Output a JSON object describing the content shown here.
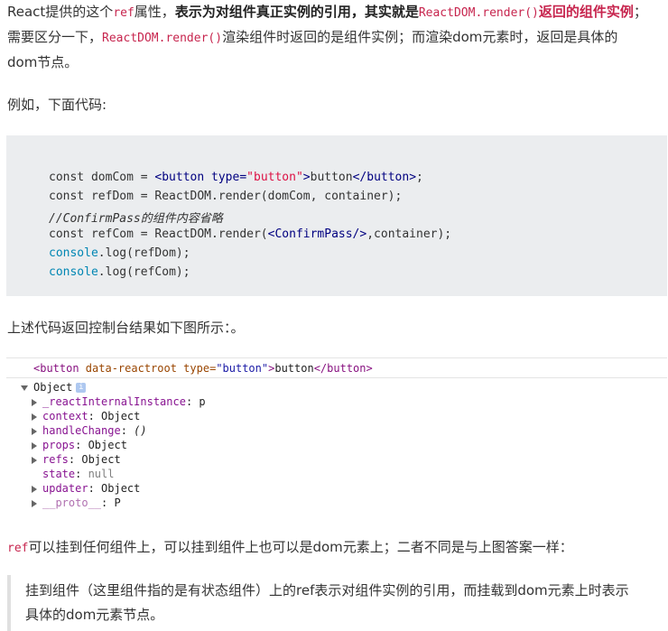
{
  "para1": {
    "line1_a": "React提供的这个",
    "line1_code1": "ref",
    "line1_b": "属性，",
    "line1_bold": "表示为对组件真正实例的引用，其实就是",
    "line1_code2": "ReactDOM.render()",
    "line1_bold2": "返回的组件实例",
    "line1_end": "；",
    "line2_a": "需要区分一下，",
    "line2_code": "ReactDOM.render()",
    "line2_b": "渲染组件时返回的是组件实例；而渲染dom元素时，返回是具体的",
    "line3": "dom节点。"
  },
  "para2": "例如，下面代码:",
  "code": {
    "l1_a": "const domCom = ",
    "l1_tag1": "<button",
    "l1_attr": " type=",
    "l1_str": "\"button\"",
    "l1_tag2": ">",
    "l1_text": "button",
    "l1_tag3": "</button>",
    "l1_end": ";",
    "l2": "const refDom = ReactDOM.render(domCom, container);",
    "l3": "//ConfirmPass的组件内容省略",
    "l4_a": "const refCom = ReactDOM.render(",
    "l4_tag": "<ConfirmPass/>",
    "l4_b": ",container);",
    "l5_obj": "console",
    "l5_rest": ".log(refDom);",
    "l6_obj": "console",
    "l6_rest": ".log(refCom);"
  },
  "para3": "上述代码返回控制台结果如下图所示：。",
  "console": {
    "row0_tag1": "<button",
    "row0_attr1": " data-reactroot",
    "row0_attr2": " type=",
    "row0_val": "\"button\"",
    "row0_tag2": ">",
    "row0_text": "button",
    "row0_tag3": "</button>",
    "object_label": "Object",
    "info_glyph": "i",
    "props": [
      {
        "key": "_reactInternalInstance",
        "value": "p",
        "expandable": true
      },
      {
        "key": "context",
        "value": "Object",
        "expandable": true
      },
      {
        "key": "handleChange",
        "value": "()",
        "expandable": true
      },
      {
        "key": "props",
        "value": "Object",
        "expandable": true
      },
      {
        "key": "refs",
        "value": "Object",
        "expandable": true
      },
      {
        "key": "state",
        "value": "null",
        "expandable": false
      },
      {
        "key": "updater",
        "value": "Object",
        "expandable": true
      },
      {
        "key": "__proto__",
        "value": "P",
        "expandable": true
      }
    ]
  },
  "para4": {
    "code": "ref",
    "text": "可以挂到任何组件上，可以挂到组件上也可以是dom元素上；二者不同是与上图答案一样："
  },
  "quote": {
    "line1": "挂到组件（这里组件指的是有状态组件）上的ref表示对组件实例的引用，而挂载到dom元素上时表示",
    "line2": "具体的dom元素节点。"
  }
}
